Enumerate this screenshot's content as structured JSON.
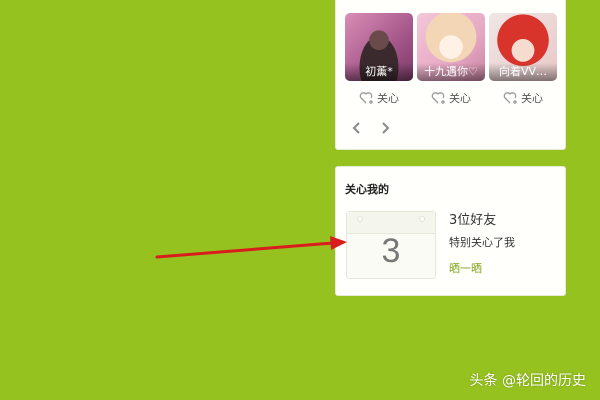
{
  "friends": [
    {
      "name": "初薰*",
      "follow_label": "关心"
    },
    {
      "name": "十九遇你♡",
      "follow_label": "关心"
    },
    {
      "name": "向着VV…",
      "follow_label": "关心"
    }
  ],
  "care_panel": {
    "title": "关心我的",
    "calendar_number": "3",
    "count_text": "3位好友",
    "description": "特别关心了我",
    "share_label": "晒一晒"
  },
  "watermark": "头条 @轮回的历史",
  "colors": {
    "page_bg": "#96c21f",
    "link": "#7fa31a",
    "arrow": "#d91c1c"
  }
}
